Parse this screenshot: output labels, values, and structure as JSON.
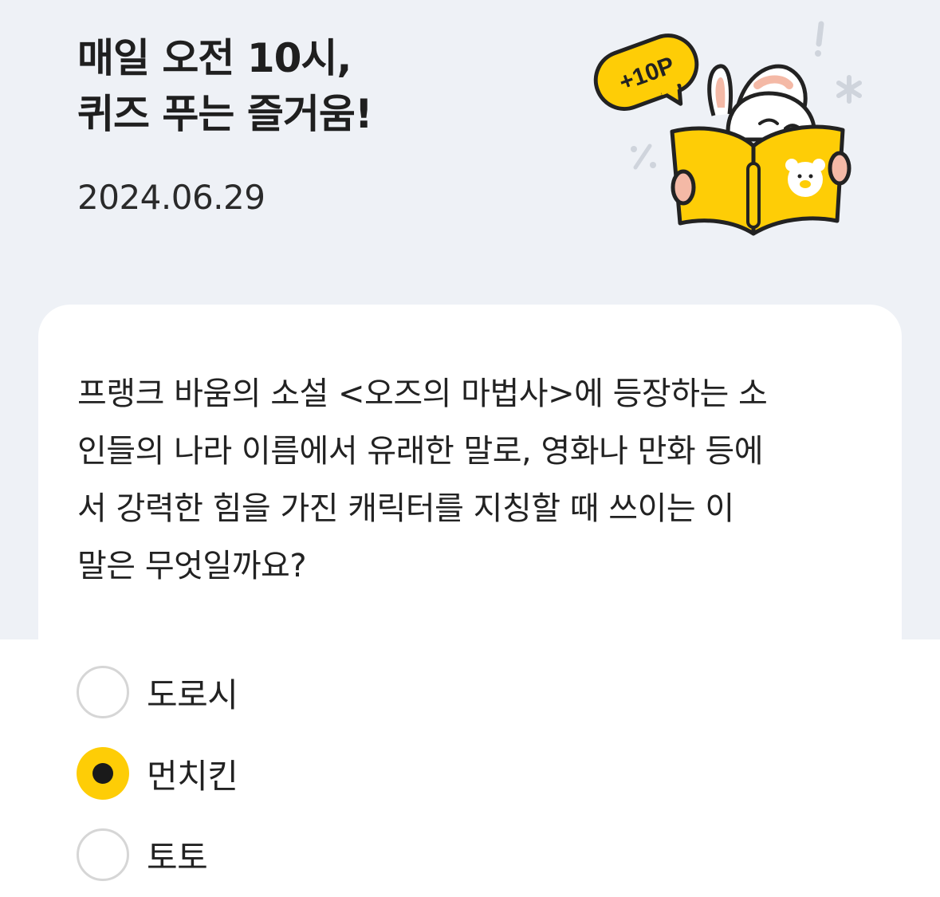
{
  "header": {
    "title_line1": "매일 오전 10시,",
    "title_line2": "퀴즈 푸는 즐거움!",
    "date": "2024.06.29",
    "badge": "+10P"
  },
  "quiz": {
    "question_lines": [
      "프랭크 바움의 소설 <오즈의 마법사>에 등장하는 소",
      "인들의 나라 이름에서 유래한 말로, 영화나 만화 등에",
      "서 강력한 힘을 가진 캐릭터를 지칭할 때 쓰이는 이",
      "말은 무엇일까요?"
    ],
    "options": [
      {
        "label": "도로시",
        "selected": false
      },
      {
        "label": "먼치킨",
        "selected": true
      },
      {
        "label": "토토",
        "selected": false
      }
    ]
  },
  "colors": {
    "accent": "#fecd06",
    "header_bg": "#eef1f6",
    "text": "#222222"
  },
  "icons": {
    "mascot": "bunny-reading-book-illustration",
    "badge": "speech-bubble-icon",
    "radio_selected": "radio-selected-icon",
    "radio_empty": "radio-empty-icon"
  }
}
